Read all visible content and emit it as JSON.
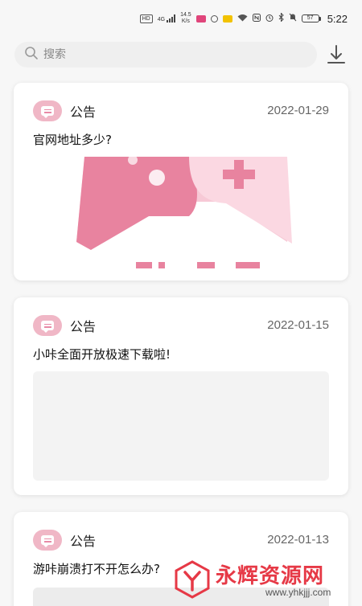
{
  "status_bar": {
    "hd_label": "HD",
    "network_label": "4G",
    "speed_value": "14.5",
    "speed_unit": "K/s",
    "battery": "57",
    "time": "5:22"
  },
  "search": {
    "placeholder": "搜索",
    "value": ""
  },
  "icons": {
    "search": "search-icon",
    "download": "download-icon",
    "announcement": "message-icon"
  },
  "colors": {
    "accent_pink": "#f0b7c6",
    "pink_dark": "#e07f9b",
    "watermark_red": "#e63946"
  },
  "cards": [
    {
      "tag": "公告",
      "date": "2022-01-29",
      "title": "官网地址多少?"
    },
    {
      "tag": "公告",
      "date": "2022-01-15",
      "title": "小咔全面开放极速下载啦!"
    },
    {
      "tag": "公告",
      "date": "2022-01-13",
      "title": "游咔崩溃打不开怎么办?"
    }
  ],
  "watermark": {
    "text": "永辉资源网",
    "url": "www.yhkjjj.com"
  }
}
